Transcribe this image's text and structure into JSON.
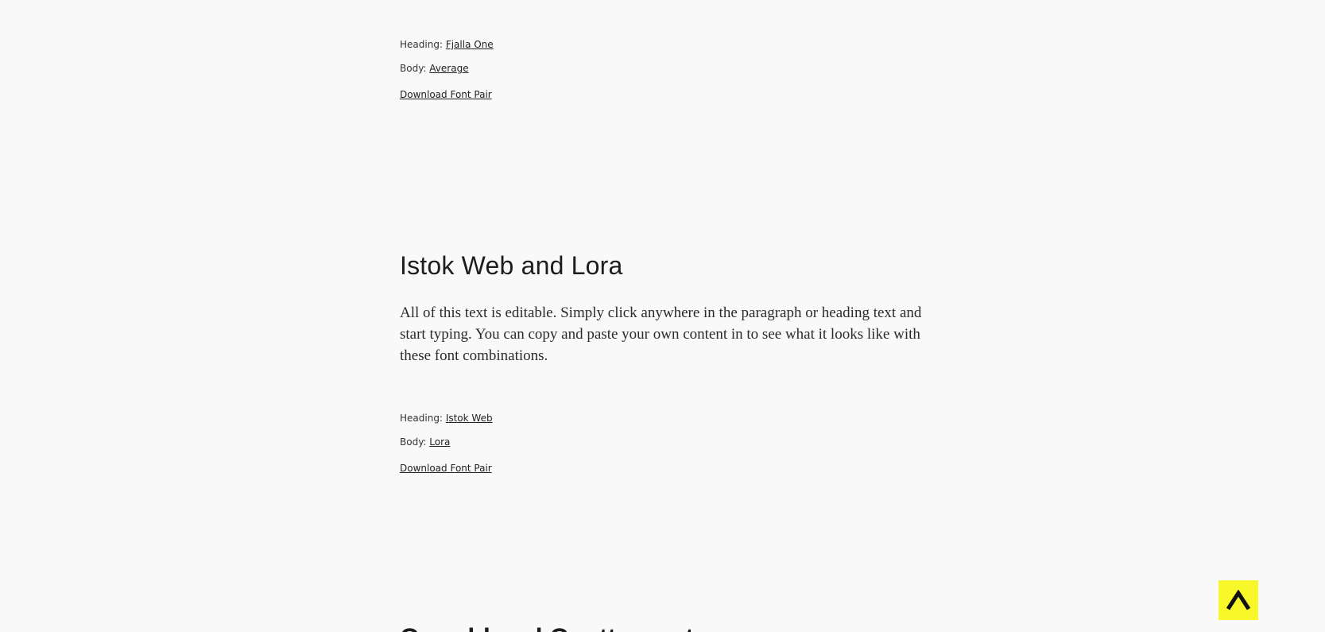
{
  "pair1": {
    "heading_label": "Heading:",
    "heading_font": "Fjalla One",
    "body_label": "Body:",
    "body_font": "Average",
    "download_label": "Download Font Pair"
  },
  "pair2": {
    "title": "Istok Web and Lora",
    "body_text": "All of this text is editable. Simply click anywhere in the paragraph or heading text and start typing. You can copy and paste your own content in to see what it looks like with these font combinations.",
    "heading_label": "Heading:",
    "heading_font": "Istok Web",
    "body_label": "Body:",
    "body_font": "Lora",
    "download_label": "Download Font Pair"
  },
  "pair3": {
    "title_partial": "Oswald and Quattrocento"
  },
  "scroll_top": {
    "icon": "caret-up-icon",
    "color": "#f7f72a"
  }
}
